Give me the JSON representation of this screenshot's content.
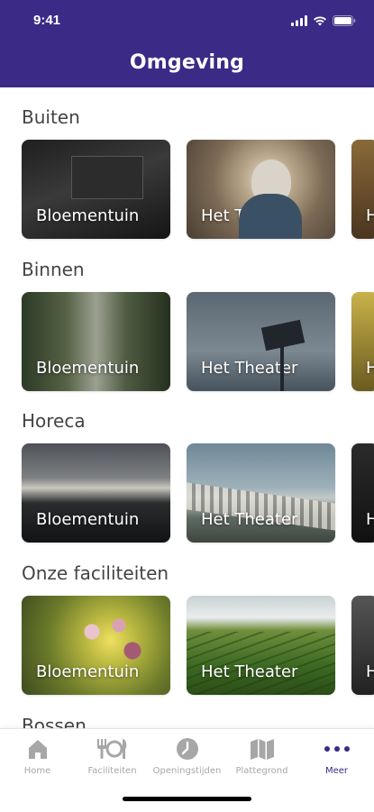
{
  "status_bar": {
    "time": "9:41"
  },
  "header": {
    "title": "Omgeving",
    "background": "#3b2a86"
  },
  "sections": [
    {
      "title": "Buiten",
      "cards": [
        {
          "label": "Bloementuin"
        },
        {
          "label": "Het Theater"
        },
        {
          "label": "H"
        }
      ]
    },
    {
      "title": "Binnen",
      "cards": [
        {
          "label": "Bloementuin"
        },
        {
          "label": "Het Theater"
        },
        {
          "label": "H"
        }
      ]
    },
    {
      "title": "Horeca",
      "cards": [
        {
          "label": "Bloementuin"
        },
        {
          "label": "Het Theater"
        },
        {
          "label": "H"
        }
      ]
    },
    {
      "title": "Onze faciliteiten",
      "cards": [
        {
          "label": "Bloementuin"
        },
        {
          "label": "Het Theater"
        },
        {
          "label": "H"
        }
      ]
    },
    {
      "title": "Bossen"
    }
  ],
  "tabbar": {
    "active_color": "#3b2a86",
    "inactive_color": "#a7a7a7",
    "items": [
      {
        "label": "Home",
        "icon": "home-icon"
      },
      {
        "label": "Faciliteiten",
        "icon": "cutlery-icon"
      },
      {
        "label": "Openingstijden",
        "icon": "clock-icon"
      },
      {
        "label": "Plattegrond",
        "icon": "map-icon"
      },
      {
        "label": "Meer",
        "icon": "more-icon",
        "active": true
      }
    ]
  }
}
